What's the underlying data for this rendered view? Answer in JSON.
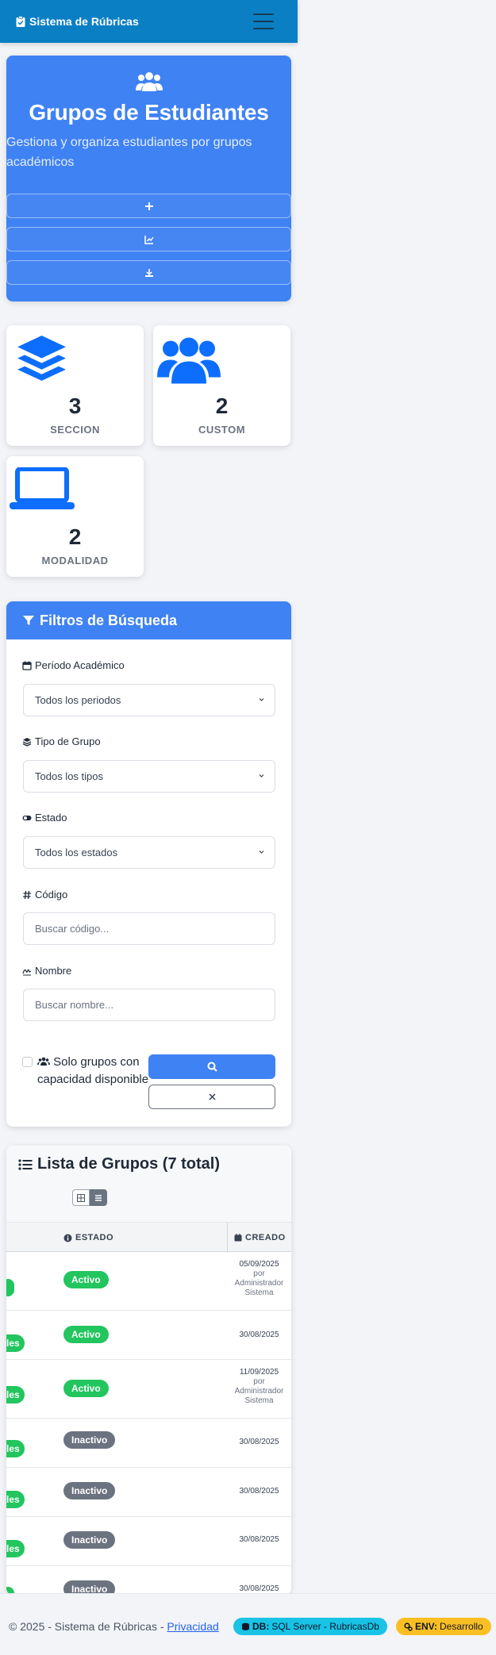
{
  "navbar": {
    "brand": "Sistema de Rúbricas"
  },
  "hero": {
    "title": "Grupos de Estudiantes",
    "subtitle": "Gestiona y organiza estudiantes por grupos académicos"
  },
  "stats": [
    {
      "value": "3",
      "label": "SECCION",
      "icon": "layer-group-icon"
    },
    {
      "value": "2",
      "label": "CUSTOM",
      "icon": "users-icon"
    },
    {
      "value": "2",
      "label": "MODALIDAD",
      "icon": "laptop-icon"
    }
  ],
  "filters": {
    "title": "Filtros de Búsqueda",
    "periodo_label": "Período Académico",
    "periodo_value": "Todos los periodos",
    "tipo_label": "Tipo de Grupo",
    "tipo_value": "Todos los tipos",
    "estado_label": "Estado",
    "estado_value": "Todos los estados",
    "codigo_label": "Código",
    "codigo_placeholder": "Buscar código...",
    "nombre_label": "Nombre",
    "nombre_placeholder": "Buscar nombre...",
    "capacidad_label": "Solo grupos con capacidad disponible"
  },
  "list": {
    "title": "Lista de Grupos (7 total)",
    "col_estado": "ESTADO",
    "col_creado": "CREADO",
    "rows": [
      {
        "edge": "",
        "estado": "Activo",
        "fecha": "05/09/2025",
        "por": "por",
        "autor": "Administrador Sistema"
      },
      {
        "edge": "les",
        "estado": "Activo",
        "fecha": "30/08/2025"
      },
      {
        "edge": "les",
        "estado": "Activo",
        "fecha": "11/09/2025",
        "por": "por",
        "autor": "Administrador Sistema"
      },
      {
        "edge": "les",
        "estado": "Inactivo",
        "fecha": "30/08/2025"
      },
      {
        "edge": "les",
        "estado": "Inactivo",
        "fecha": "30/08/2025"
      },
      {
        "edge": "les",
        "estado": "Inactivo",
        "fecha": "30/08/2025"
      },
      {
        "edge": "",
        "estado": "Inactivo",
        "fecha": "30/08/2025"
      }
    ]
  },
  "footer": {
    "copyright": "© 2025 - Sistema de Rúbricas - ",
    "privacy": "Privacidad",
    "db_label": "DB:",
    "db_value": "SQL Server - RubricasDb",
    "env_label": "ENV:",
    "env_value": "Desarrollo"
  },
  "colors": {
    "primary": "#3f82f3",
    "navbar": "#0b7fc4",
    "success": "#22c55e",
    "muted": "#6b7280",
    "info": "#19c3e6",
    "warning": "#fbbf24"
  }
}
